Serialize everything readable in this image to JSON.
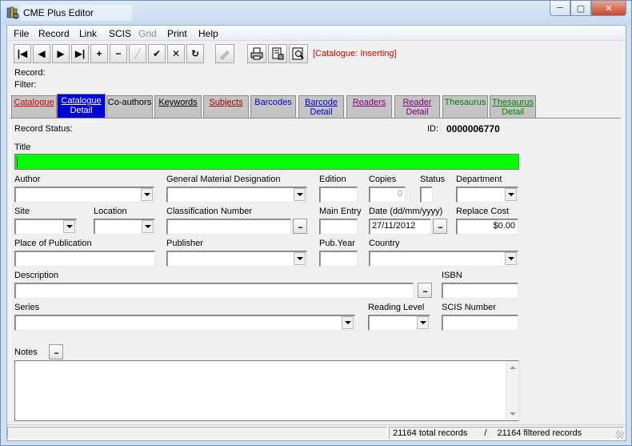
{
  "window": {
    "title": "CME Plus Editor",
    "minimize": "─",
    "maximize": "▢",
    "close": "✕"
  },
  "menu": [
    "File",
    "Record",
    "Link",
    "SCIS",
    "Grid",
    "Print",
    "Help"
  ],
  "toolbar": {
    "first": "|◀",
    "prev": "◀",
    "next": "▶",
    "last": "▶|",
    "add": "+",
    "delete": "−",
    "edit": "╱",
    "post": "✔",
    "cancel": "✕",
    "refresh": "↻",
    "status": "[Catalogue: Inserting]"
  },
  "info": {
    "record_label": "Record:",
    "filter_label": "Filter:"
  },
  "tabs": [
    {
      "label": "Catalogue",
      "color": "#d00000"
    },
    {
      "label": "Catalogue Detail",
      "line1": "Catalogue",
      "line2": "Detail",
      "color": "#ffffff"
    },
    {
      "label": "Co-authors",
      "color": "#000000"
    },
    {
      "label": "Keywords",
      "color": "#000000"
    },
    {
      "label": "Subjects",
      "color": "#a00000"
    },
    {
      "label": "Barcodes",
      "color": "#0000cc"
    },
    {
      "label": "Barcode Detail",
      "line1": "Barcode",
      "line2": "Detail",
      "color": "#0000cc"
    },
    {
      "label": "Readers",
      "color": "#800080"
    },
    {
      "label": "Reader Detail",
      "line1": "Reader",
      "line2": "Detail",
      "color": "#800080"
    },
    {
      "label": "Thesaurus",
      "color": "#008000"
    },
    {
      "label": "Thesaurus Detail",
      "line1": "Thesaurus",
      "line2": "Detail",
      "color": "#008000"
    }
  ],
  "form": {
    "record_status_label": "Record Status:",
    "id_label": "ID:",
    "id_value": "0000006770",
    "title_label": "Title",
    "author_label": "Author",
    "gmd_label": "General Material Designation",
    "edition_label": "Edition",
    "copies_label": "Copies",
    "copies_value": "0",
    "status_label": "Status",
    "department_label": "Department",
    "site_label": "Site",
    "location_label": "Location",
    "classification_label": "Classification Number",
    "main_entry_label": "Main Entry",
    "date_label": "Date (dd/mm/yyyy)",
    "date_value": "27/11/2012",
    "replace_cost_label": "Replace Cost",
    "replace_cost_value": "$0.00",
    "place_label": "Place of Publication",
    "publisher_label": "Publisher",
    "pub_year_label": "Pub.Year",
    "country_label": "Country",
    "description_label": "Description",
    "isbn_label": "ISBN",
    "series_label": "Series",
    "reading_level_label": "Reading Level",
    "scis_number_label": "SCIS Number",
    "notes_label": "Notes",
    "dots": "..."
  },
  "statusbar": {
    "total": "21164 total records",
    "separator": "/",
    "filtered": "21164 filtered records"
  }
}
